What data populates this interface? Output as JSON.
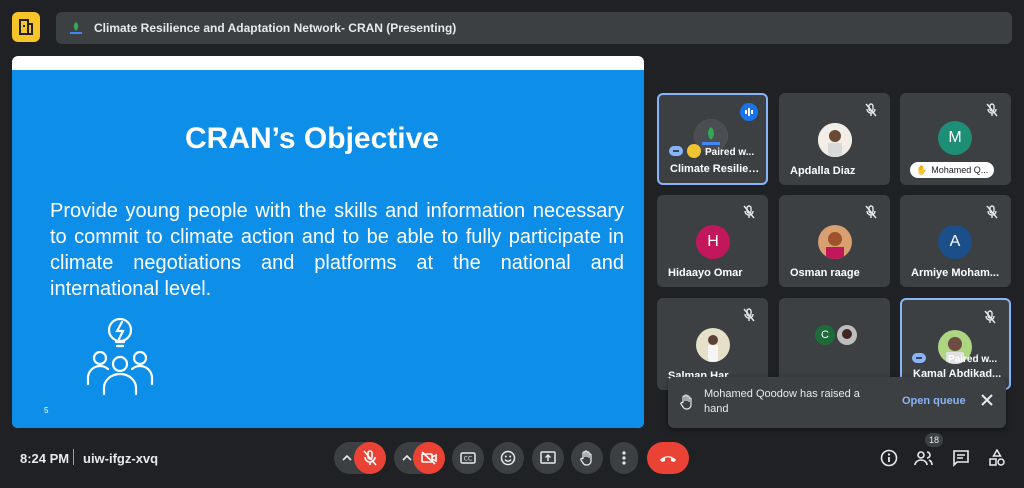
{
  "header": {
    "title": "Climate Resilience and Adaptation Network- CRAN (Presenting)"
  },
  "slide": {
    "title": "CRAN’s Objective",
    "body": "Provide young people with the skills and information necessary to commit to climate action and to be able to fully participate in climate negotiations and platforms at the national and international level.",
    "page_number": "5"
  },
  "tiles": [
    {
      "name": "Climate Resilien...",
      "paired": "Paired w..."
    },
    {
      "name": "Apdalla Diaz"
    },
    {
      "initial": "M",
      "pill": "Mohamed Q..."
    },
    {
      "initial": "H",
      "name": "Hidaayo Omar"
    },
    {
      "name": "Osman raage"
    },
    {
      "initial": "A",
      "name": "Armiye Moham..."
    },
    {
      "name": "Salman Har..."
    },
    {
      "initial": "C"
    },
    {
      "name": "Kamal Abdikad...",
      "paired": "Paired w..."
    }
  ],
  "toast": {
    "message": "Mohamed Qoodow has raised a hand",
    "action": "Open queue"
  },
  "footer": {
    "time": "8:24 PM",
    "meeting_code": "uiw-ifgz-xvq",
    "participant_count": "18"
  },
  "colors": {
    "slide_bg": "#0d8ee8",
    "end_call": "#ea4335",
    "accent": "#8ab4f8"
  }
}
